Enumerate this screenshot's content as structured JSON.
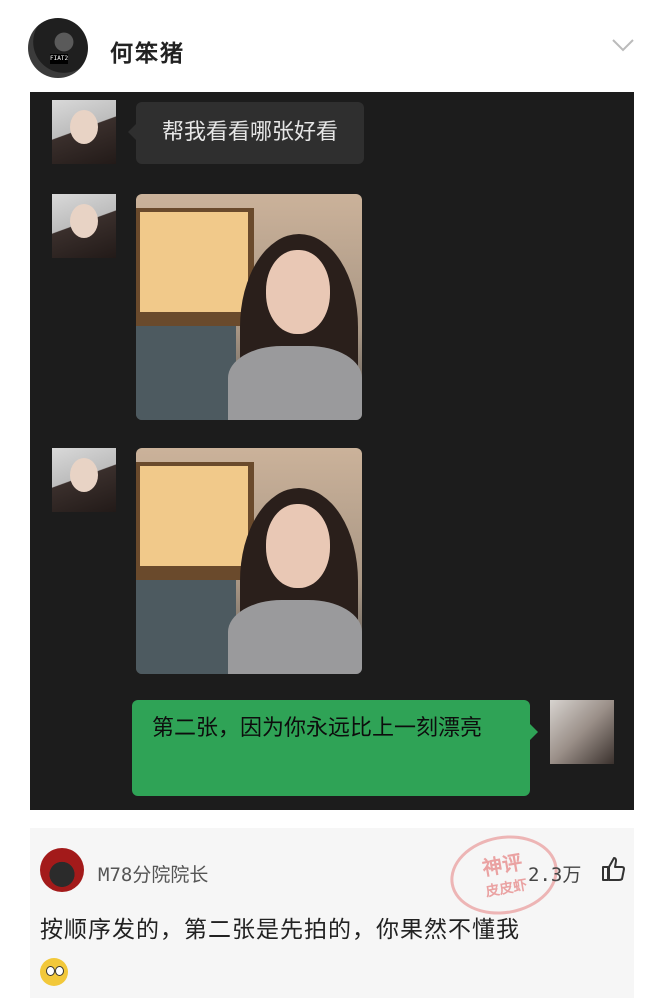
{
  "post": {
    "author_name": "何笨猪",
    "avatar_patch_text": "FIAT2"
  },
  "chat": {
    "incoming_text": "帮我看看哪张好看",
    "reply_text": "第二张，因为你永远比上一刻漂亮"
  },
  "comment": {
    "user": "M78分院院长",
    "likes": "2.3万",
    "text": "按顺序发的，第二张是先拍的，你果然不懂我",
    "stamp_top": "神评",
    "stamp_bottom": "皮皮虾"
  },
  "colors": {
    "chat_bg": "#1c1c1c",
    "incoming_bubble": "#2f2f2f",
    "outgoing_bubble": "#2fa356",
    "comment_bg": "#f6f6f6"
  }
}
